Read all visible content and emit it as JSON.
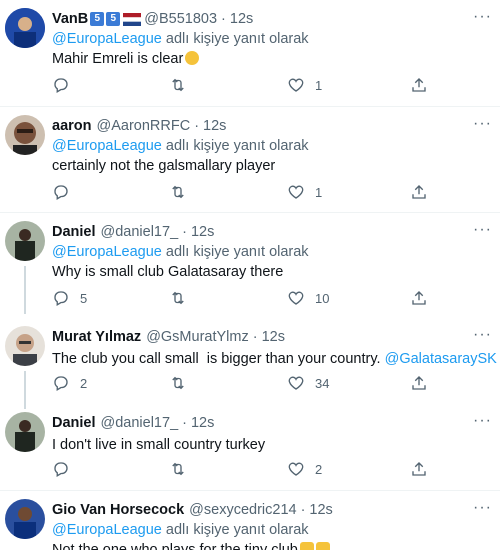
{
  "reply_label_suffix": "adlı kişiye yanıt olarak",
  "tweets": [
    {
      "name": "VanB",
      "badges": [
        "5",
        "5"
      ],
      "handle": "@B551803",
      "time": "12s",
      "reply_to": "@EuropaLeague",
      "text": "Mahir Emreli is clear",
      "replies": "",
      "retweets": "",
      "likes": "1",
      "avatar_color": "#1f4aa8"
    },
    {
      "name": "aaron",
      "handle": "@AaronRRFC",
      "time": "12s",
      "reply_to": "@EuropaLeague",
      "text": "certainly not the galsmallary player",
      "replies": "",
      "retweets": "",
      "likes": "1",
      "avatar_color": "#6b4a38"
    },
    {
      "name": "Daniel",
      "handle": "@daniel17_",
      "time": "12s",
      "reply_to": "@EuropaLeague",
      "text": "Why is small club Galatasaray there",
      "replies": "5",
      "retweets": "",
      "likes": "10",
      "avatar_color": "#2f3a2e"
    },
    {
      "name": "Murat Yılmaz",
      "handle": "@GsMuratYlmz",
      "time": "12s",
      "text_prefix": "The club you call small  is bigger than your country. ",
      "text_link": "@GalatasaraySK",
      "replies": "2",
      "retweets": "",
      "likes": "34",
      "avatar_color": "#c9b9a2"
    },
    {
      "name": "Daniel",
      "handle": "@daniel17_",
      "time": "12s",
      "text": "I don't live in small country turkey",
      "replies": "",
      "retweets": "",
      "likes": "2",
      "avatar_color": "#2f3a2e"
    },
    {
      "name": "Gio Van Horsecock",
      "handle": "@sexycedric214",
      "time": "12s",
      "reply_to": "@EuropaLeague",
      "text": "Not the one who plays for the tiny club",
      "avatar_color": "#2a4f9e"
    }
  ],
  "colors": {
    "link": "#1d9bf0",
    "muted": "#536471",
    "text": "#0f1419"
  }
}
